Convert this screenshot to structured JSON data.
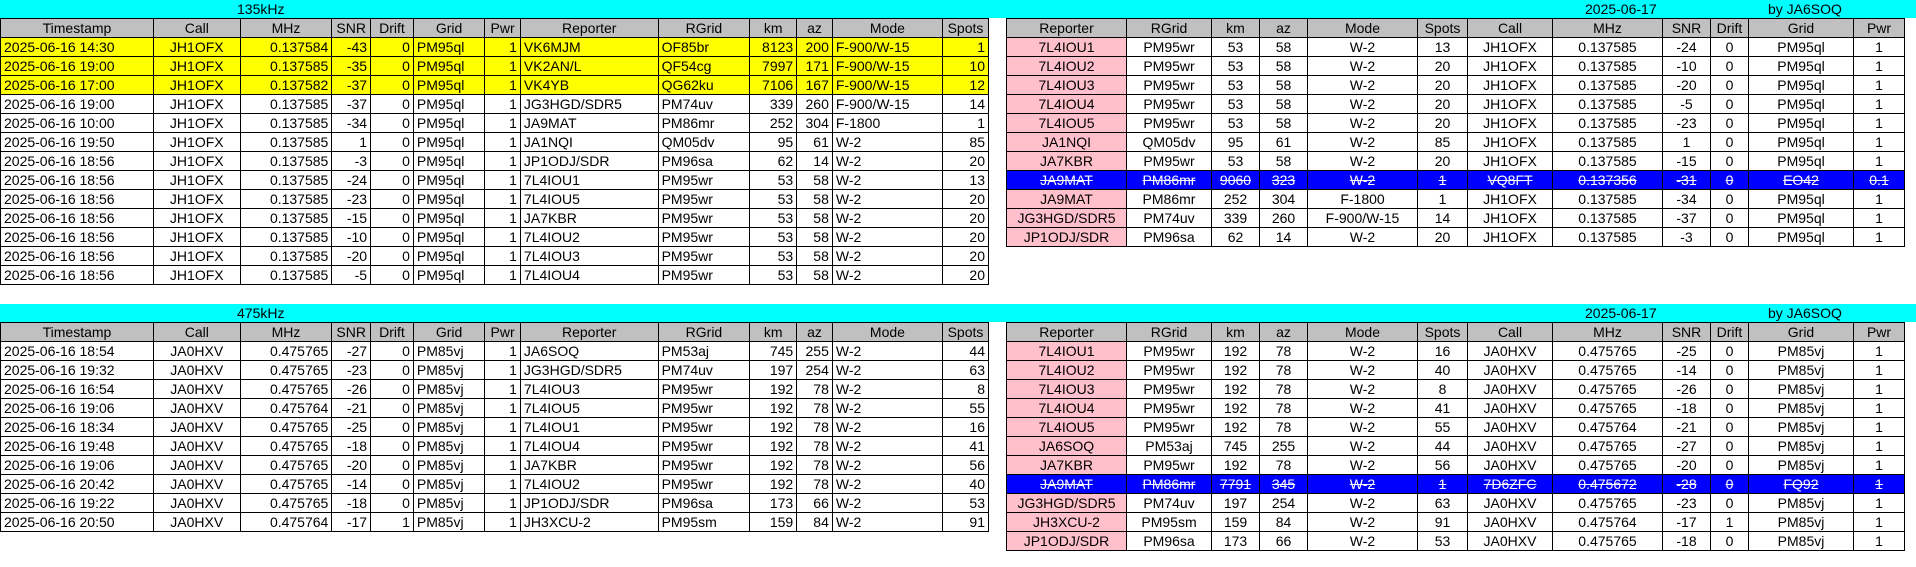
{
  "left_columns": [
    "Timestamp",
    "Call",
    "MHz",
    "SNR",
    "Drift",
    "Grid",
    "Pwr",
    "Reporter",
    "RGrid",
    "km",
    "az",
    "Mode",
    "Spots"
  ],
  "right_columns": [
    "Reporter",
    "RGrid",
    "km",
    "az",
    "Mode",
    "Spots",
    "Call",
    "MHz",
    "SNR",
    "Drift",
    "Grid",
    "Pwr"
  ],
  "band1": {
    "label": "135kHz",
    "date": "2025-06-17",
    "by": "by JA6SOQ",
    "left_rows": [
      {
        "hl": "yellow",
        "cells": [
          "2025-06-16 14:30",
          "JH1OFX",
          "0.137584",
          "-43",
          "0",
          "PM95ql",
          "1",
          "VK6MJM",
          "OF85br",
          "8123",
          "200",
          "F-900/W-15",
          "1"
        ]
      },
      {
        "hl": "yellow",
        "cells": [
          "2025-06-16 19:00",
          "JH1OFX",
          "0.137585",
          "-35",
          "0",
          "PM95ql",
          "1",
          "VK2AN/L",
          "QF54cg",
          "7997",
          "171",
          "F-900/W-15",
          "10"
        ]
      },
      {
        "hl": "yellow",
        "cells": [
          "2025-06-16 17:00",
          "JH1OFX",
          "0.137582",
          "-37",
          "0",
          "PM95ql",
          "1",
          "VK4YB",
          "QG62ku",
          "7106",
          "167",
          "F-900/W-15",
          "12"
        ]
      },
      {
        "hl": "",
        "cells": [
          "2025-06-16 19:00",
          "JH1OFX",
          "0.137585",
          "-37",
          "0",
          "PM95ql",
          "1",
          "JG3HGD/SDR5",
          "PM74uv",
          "339",
          "260",
          "F-900/W-15",
          "14"
        ]
      },
      {
        "hl": "",
        "cells": [
          "2025-06-16 10:00",
          "JH1OFX",
          "0.137585",
          "-34",
          "0",
          "PM95ql",
          "1",
          "JA9MAT",
          "PM86mr",
          "252",
          "304",
          "F-1800",
          "1"
        ]
      },
      {
        "hl": "",
        "cells": [
          "2025-06-16 19:50",
          "JH1OFX",
          "0.137585",
          "1",
          "0",
          "PM95ql",
          "1",
          "JA1NQI",
          "QM05dv",
          "95",
          "61",
          "W-2",
          "85"
        ]
      },
      {
        "hl": "",
        "cells": [
          "2025-06-16 18:56",
          "JH1OFX",
          "0.137585",
          "-3",
          "0",
          "PM95ql",
          "1",
          "JP1ODJ/SDR",
          "PM96sa",
          "62",
          "14",
          "W-2",
          "20"
        ]
      },
      {
        "hl": "",
        "cells": [
          "2025-06-16 18:56",
          "JH1OFX",
          "0.137585",
          "-24",
          "0",
          "PM95ql",
          "1",
          "7L4IOU1",
          "PM95wr",
          "53",
          "58",
          "W-2",
          "13"
        ]
      },
      {
        "hl": "",
        "cells": [
          "2025-06-16 18:56",
          "JH1OFX",
          "0.137585",
          "-23",
          "0",
          "PM95ql",
          "1",
          "7L4IOU5",
          "PM95wr",
          "53",
          "58",
          "W-2",
          "20"
        ]
      },
      {
        "hl": "",
        "cells": [
          "2025-06-16 18:56",
          "JH1OFX",
          "0.137585",
          "-15",
          "0",
          "PM95ql",
          "1",
          "JA7KBR",
          "PM95wr",
          "53",
          "58",
          "W-2",
          "20"
        ]
      },
      {
        "hl": "",
        "cells": [
          "2025-06-16 18:56",
          "JH1OFX",
          "0.137585",
          "-10",
          "0",
          "PM95ql",
          "1",
          "7L4IOU2",
          "PM95wr",
          "53",
          "58",
          "W-2",
          "20"
        ]
      },
      {
        "hl": "",
        "cells": [
          "2025-06-16 18:56",
          "JH1OFX",
          "0.137585",
          "-20",
          "0",
          "PM95ql",
          "1",
          "7L4IOU3",
          "PM95wr",
          "53",
          "58",
          "W-2",
          "20"
        ]
      },
      {
        "hl": "",
        "cells": [
          "2025-06-16 18:56",
          "JH1OFX",
          "0.137585",
          "-5",
          "0",
          "PM95ql",
          "1",
          "7L4IOU4",
          "PM95wr",
          "53",
          "58",
          "W-2",
          "20"
        ]
      }
    ],
    "right_rows": [
      {
        "hl": "",
        "cells": [
          "7L4IOU1",
          "PM95wr",
          "53",
          "58",
          "W-2",
          "13",
          "JH1OFX",
          "0.137585",
          "-24",
          "0",
          "PM95ql",
          "1"
        ]
      },
      {
        "hl": "",
        "cells": [
          "7L4IOU2",
          "PM95wr",
          "53",
          "58",
          "W-2",
          "20",
          "JH1OFX",
          "0.137585",
          "-10",
          "0",
          "PM95ql",
          "1"
        ]
      },
      {
        "hl": "",
        "cells": [
          "7L4IOU3",
          "PM95wr",
          "53",
          "58",
          "W-2",
          "20",
          "JH1OFX",
          "0.137585",
          "-20",
          "0",
          "PM95ql",
          "1"
        ]
      },
      {
        "hl": "",
        "cells": [
          "7L4IOU4",
          "PM95wr",
          "53",
          "58",
          "W-2",
          "20",
          "JH1OFX",
          "0.137585",
          "-5",
          "0",
          "PM95ql",
          "1"
        ]
      },
      {
        "hl": "",
        "cells": [
          "7L4IOU5",
          "PM95wr",
          "53",
          "58",
          "W-2",
          "20",
          "JH1OFX",
          "0.137585",
          "-23",
          "0",
          "PM95ql",
          "1"
        ]
      },
      {
        "hl": "",
        "cells": [
          "JA1NQI",
          "QM05dv",
          "95",
          "61",
          "W-2",
          "85",
          "JH1OFX",
          "0.137585",
          "1",
          "0",
          "PM95ql",
          "1"
        ]
      },
      {
        "hl": "",
        "cells": [
          "JA7KBR",
          "PM95wr",
          "53",
          "58",
          "W-2",
          "20",
          "JH1OFX",
          "0.137585",
          "-15",
          "0",
          "PM95ql",
          "1"
        ]
      },
      {
        "hl": "strike",
        "cells": [
          "JA9MAT",
          "PM86mr",
          "9060",
          "323",
          "W-2",
          "1",
          "VQ8FT",
          "0.137356",
          "-31",
          "0",
          "EO42",
          "0.1"
        ]
      },
      {
        "hl": "",
        "cells": [
          "JA9MAT",
          "PM86mr",
          "252",
          "304",
          "F-1800",
          "1",
          "JH1OFX",
          "0.137585",
          "-34",
          "0",
          "PM95ql",
          "1"
        ]
      },
      {
        "hl": "",
        "cells": [
          "JG3HGD/SDR5",
          "PM74uv",
          "339",
          "260",
          "F-900/W-15",
          "14",
          "JH1OFX",
          "0.137585",
          "-37",
          "0",
          "PM95ql",
          "1"
        ]
      },
      {
        "hl": "",
        "cells": [
          "JP1ODJ/SDR",
          "PM96sa",
          "62",
          "14",
          "W-2",
          "20",
          "JH1OFX",
          "0.137585",
          "-3",
          "0",
          "PM95ql",
          "1"
        ]
      }
    ]
  },
  "band2": {
    "label": "475kHz",
    "date": "2025-06-17",
    "by": "by JA6SOQ",
    "left_rows": [
      {
        "hl": "",
        "cells": [
          "2025-06-16 18:54",
          "JA0HXV",
          "0.475765",
          "-27",
          "0",
          "PM85vj",
          "1",
          "JA6SOQ",
          "PM53aj",
          "745",
          "255",
          "W-2",
          "44"
        ]
      },
      {
        "hl": "",
        "cells": [
          "2025-06-16 19:32",
          "JA0HXV",
          "0.475765",
          "-23",
          "0",
          "PM85vj",
          "1",
          "JG3HGD/SDR5",
          "PM74uv",
          "197",
          "254",
          "W-2",
          "63"
        ]
      },
      {
        "hl": "",
        "cells": [
          "2025-06-16 16:54",
          "JA0HXV",
          "0.475765",
          "-26",
          "0",
          "PM85vj",
          "1",
          "7L4IOU3",
          "PM95wr",
          "192",
          "78",
          "W-2",
          "8"
        ]
      },
      {
        "hl": "",
        "cells": [
          "2025-06-16 19:06",
          "JA0HXV",
          "0.475764",
          "-21",
          "0",
          "PM85vj",
          "1",
          "7L4IOU5",
          "PM95wr",
          "192",
          "78",
          "W-2",
          "55"
        ]
      },
      {
        "hl": "",
        "cells": [
          "2025-06-16 18:34",
          "JA0HXV",
          "0.475765",
          "-25",
          "0",
          "PM85vj",
          "1",
          "7L4IOU1",
          "PM95wr",
          "192",
          "78",
          "W-2",
          "16"
        ]
      },
      {
        "hl": "",
        "cells": [
          "2025-06-16 19:48",
          "JA0HXV",
          "0.475765",
          "-18",
          "0",
          "PM85vj",
          "1",
          "7L4IOU4",
          "PM95wr",
          "192",
          "78",
          "W-2",
          "41"
        ]
      },
      {
        "hl": "",
        "cells": [
          "2025-06-16 19:06",
          "JA0HXV",
          "0.475765",
          "-20",
          "0",
          "PM85vj",
          "1",
          "JA7KBR",
          "PM95wr",
          "192",
          "78",
          "W-2",
          "56"
        ]
      },
      {
        "hl": "",
        "cells": [
          "2025-06-16 20:42",
          "JA0HXV",
          "0.475765",
          "-14",
          "0",
          "PM85vj",
          "1",
          "7L4IOU2",
          "PM95wr",
          "192",
          "78",
          "W-2",
          "40"
        ]
      },
      {
        "hl": "",
        "cells": [
          "2025-06-16 19:22",
          "JA0HXV",
          "0.475765",
          "-18",
          "0",
          "PM85vj",
          "1",
          "JP1ODJ/SDR",
          "PM96sa",
          "173",
          "66",
          "W-2",
          "53"
        ]
      },
      {
        "hl": "",
        "cells": [
          "2025-06-16 20:50",
          "JA0HXV",
          "0.475764",
          "-17",
          "1",
          "PM85vj",
          "1",
          "JH3XCU-2",
          "PM95sm",
          "159",
          "84",
          "W-2",
          "91"
        ]
      }
    ],
    "right_rows": [
      {
        "hl": "",
        "cells": [
          "7L4IOU1",
          "PM95wr",
          "192",
          "78",
          "W-2",
          "16",
          "JA0HXV",
          "0.475765",
          "-25",
          "0",
          "PM85vj",
          "1"
        ]
      },
      {
        "hl": "",
        "cells": [
          "7L4IOU2",
          "PM95wr",
          "192",
          "78",
          "W-2",
          "40",
          "JA0HXV",
          "0.475765",
          "-14",
          "0",
          "PM85vj",
          "1"
        ]
      },
      {
        "hl": "",
        "cells": [
          "7L4IOU3",
          "PM95wr",
          "192",
          "78",
          "W-2",
          "8",
          "JA0HXV",
          "0.475765",
          "-26",
          "0",
          "PM85vj",
          "1"
        ]
      },
      {
        "hl": "",
        "cells": [
          "7L4IOU4",
          "PM95wr",
          "192",
          "78",
          "W-2",
          "41",
          "JA0HXV",
          "0.475765",
          "-18",
          "0",
          "PM85vj",
          "1"
        ]
      },
      {
        "hl": "",
        "cells": [
          "7L4IOU5",
          "PM95wr",
          "192",
          "78",
          "W-2",
          "55",
          "JA0HXV",
          "0.475764",
          "-21",
          "0",
          "PM85vj",
          "1"
        ]
      },
      {
        "hl": "",
        "cells": [
          "JA6SOQ",
          "PM53aj",
          "745",
          "255",
          "W-2",
          "44",
          "JA0HXV",
          "0.475765",
          "-27",
          "0",
          "PM85vj",
          "1"
        ]
      },
      {
        "hl": "",
        "cells": [
          "JA7KBR",
          "PM95wr",
          "192",
          "78",
          "W-2",
          "56",
          "JA0HXV",
          "0.475765",
          "-20",
          "0",
          "PM85vj",
          "1"
        ]
      },
      {
        "hl": "strike",
        "cells": [
          "JA9MAT",
          "PM86mr",
          "7791",
          "345",
          "W-2",
          "1",
          "7D6ZFC",
          "0.475672",
          "-28",
          "0",
          "FQ92",
          "1"
        ]
      },
      {
        "hl": "",
        "cells": [
          "JG3HGD/SDR5",
          "PM74uv",
          "197",
          "254",
          "W-2",
          "63",
          "JA0HXV",
          "0.475765",
          "-23",
          "0",
          "PM85vj",
          "1"
        ]
      },
      {
        "hl": "",
        "cells": [
          "JH3XCU-2",
          "PM95sm",
          "159",
          "84",
          "W-2",
          "91",
          "JA0HXV",
          "0.475764",
          "-17",
          "1",
          "PM85vj",
          "1"
        ]
      },
      {
        "hl": "",
        "cells": [
          "JP1ODJ/SDR",
          "PM96sa",
          "173",
          "66",
          "W-2",
          "53",
          "JA0HXV",
          "0.475765",
          "-18",
          "0",
          "PM85vj",
          "1"
        ]
      }
    ]
  }
}
